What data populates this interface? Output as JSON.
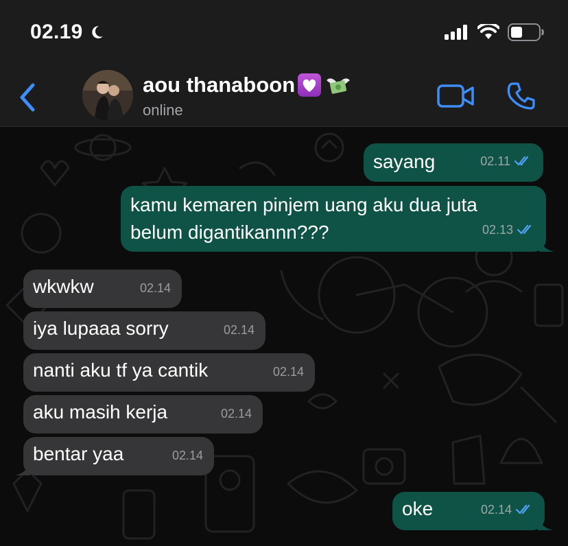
{
  "status_bar": {
    "time": "02.19",
    "icons": [
      "moon-icon",
      "cellular-signal-icon",
      "wifi-icon",
      "battery-icon"
    ]
  },
  "header": {
    "contact_name": "aou thanaboon",
    "name_emojis": [
      "purple-heart-emoji",
      "money-with-wings-emoji"
    ],
    "contact_status": "online",
    "accent_color": "#3e8ef7"
  },
  "messages": [
    {
      "direction": "out",
      "text": "sayang",
      "time": "02.11",
      "read": true
    },
    {
      "direction": "out",
      "text_lines": [
        "kamu kemaren pinjem uang aku dua juta",
        "belum digantikannn???"
      ],
      "time": "02.13",
      "read": true
    },
    {
      "direction": "in",
      "text": "wkwkw",
      "time": "02.14"
    },
    {
      "direction": "in",
      "text": "iya lupaaa sorry",
      "time": "02.14"
    },
    {
      "direction": "in",
      "text": "nanti aku tf ya cantik",
      "time": "02.14"
    },
    {
      "direction": "in",
      "text": "aku masih kerja",
      "time": "02.14"
    },
    {
      "direction": "in",
      "text": "bentar yaa",
      "time": "02.14"
    },
    {
      "direction": "out",
      "text": "oke",
      "time": "02.14",
      "read": true
    }
  ],
  "colors": {
    "outgoing_bubble": "#0f5346",
    "incoming_bubble": "#363638",
    "read_ticks": "#4fa3f7",
    "header_bg": "#1c1c1d"
  }
}
